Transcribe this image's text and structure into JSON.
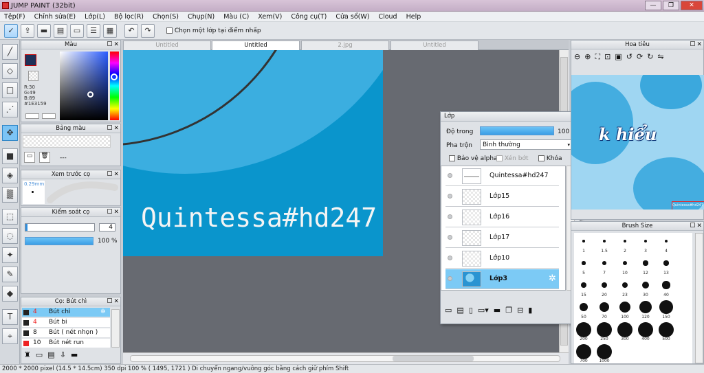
{
  "window": {
    "title": "JUMP PAINT (32bit)",
    "min": "—",
    "max": "❐",
    "close": "✕"
  },
  "menu": [
    "Tệp(F)",
    "Chỉnh sửa(E)",
    "Lớp(L)",
    "Bộ lọc(R)",
    "Chọn(S)",
    "Chụp(N)",
    "Màu (C)",
    "Xem(V)",
    "Công cụ(T)",
    "Cửa sổ(W)",
    "Cloud",
    "Help"
  ],
  "toolbar": {
    "select_layer_at_point": "Chọn một lớp tại điểm nhấp"
  },
  "color_panel": {
    "title": "Màu",
    "r": "R:30",
    "g": "G:49",
    "b": "B:89",
    "hex": "#1E3159",
    "primary_color": "#1E3159"
  },
  "swatch_panel": {
    "title": "Bảng màu",
    "value": "---"
  },
  "brush_preview": {
    "title": "Xem trước cọ",
    "size": "0.29mm"
  },
  "brush_control": {
    "title": "Kiểm soát cọ",
    "size_value": "4",
    "opacity_value": "100 %"
  },
  "brush_list": {
    "title": "Cọ: Bút chì",
    "items": [
      {
        "size": "4",
        "name": "Bút chì",
        "color": "#ff2222"
      },
      {
        "size": "4",
        "name": "Bút bi",
        "color": "#ff2222"
      },
      {
        "size": "8",
        "name": "Bút ( nét nhọn )",
        "color": "#222222"
      },
      {
        "size": "10",
        "name": "Bút nét run",
        "color": "#ee2222"
      }
    ]
  },
  "tabs": [
    "Untitled",
    "Untitled",
    "2.jpg",
    "Untitled"
  ],
  "canvas": {
    "text": "Quintessa#hd247"
  },
  "layers_panel": {
    "title": "Lớp",
    "opacity_label": "Độ trong",
    "opacity_value": "100 %",
    "blend_label": "Pha trộn",
    "blend_value": "Bình thường",
    "protect_alpha": "Bảo vệ alpha",
    "clip": "Xén bớt",
    "lock": "Khóa",
    "layers": [
      {
        "name": "Quintessa#hd247"
      },
      {
        "name": "Lớp15"
      },
      {
        "name": "Lớp16"
      },
      {
        "name": "Lớp17"
      },
      {
        "name": "Lớp10"
      },
      {
        "name": "Lớp3"
      }
    ]
  },
  "navigator": {
    "title": "Hoa tiêu",
    "thumb_text": "k hiểu",
    "thumb_sub": "Quintessa#hd247"
  },
  "brush_size": {
    "title": "Brush Size",
    "sizes": [
      "1",
      "1.5",
      "2",
      "3",
      "4",
      "5",
      "7",
      "10",
      "12",
      "13",
      "15",
      "20",
      "23",
      "30",
      "40",
      "50",
      "70",
      "100",
      "120",
      "150",
      "200",
      "250",
      "300",
      "400",
      "500",
      "700",
      "1000"
    ]
  },
  "status": {
    "text": "2000 * 2000 pixel   (14.5 * 14.5cm)   350 dpi   100 %   ( 1495, 1721 )   Di chuyển ngang/vuông góc bằng cách giữ phím Shift"
  }
}
